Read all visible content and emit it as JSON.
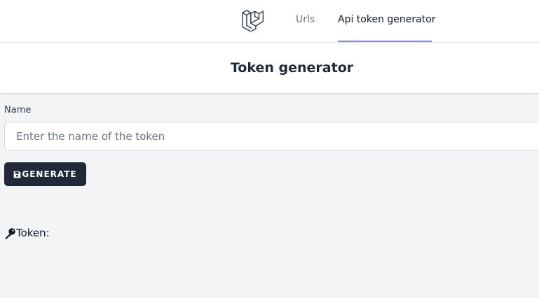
{
  "nav": {
    "logo_icon": "laravel-logo-icon",
    "links": [
      {
        "label": "Urls",
        "active": false
      },
      {
        "label": "Api token generator",
        "active": true
      }
    ],
    "active_underline_color": "#818cf8"
  },
  "header": {
    "title": "Token generator"
  },
  "form": {
    "name_label": "Name",
    "name_placeholder": "Enter the name of the token",
    "name_value": "",
    "generate_icon": "save-icon",
    "generate_label": "GENERATE"
  },
  "result": {
    "icon": "key-icon",
    "label": "Token:",
    "value": ""
  },
  "colors": {
    "button_bg": "#1f2937",
    "page_bg": "#f3f4f6"
  }
}
